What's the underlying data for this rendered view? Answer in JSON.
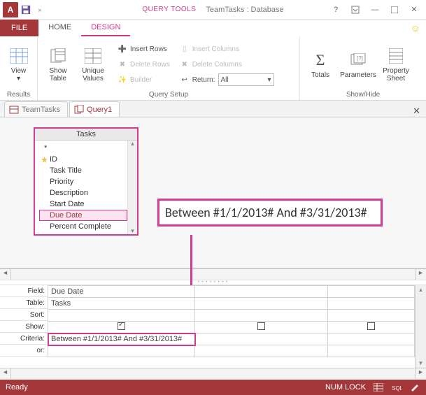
{
  "qat": {
    "app_icon_letter": "A"
  },
  "titlebar": {
    "context_tab": "QUERY TOOLS",
    "db_title": "TeamTasks : Database"
  },
  "tabs": {
    "file": "FILE",
    "home": "HOME",
    "design": "DESIGN"
  },
  "ribbon": {
    "results": {
      "view": "View",
      "label": "Results"
    },
    "querysetup": {
      "show_table": "Show\nTable",
      "unique_values": "Unique\nValues",
      "insert_rows": "Insert Rows",
      "delete_rows": "Delete Rows",
      "builder": "Builder",
      "insert_columns": "Insert Columns",
      "delete_columns": "Delete Columns",
      "return_label": "Return:",
      "return_value": "All",
      "label": "Query Setup"
    },
    "showhide": {
      "totals": "Totals",
      "parameters": "Parameters",
      "property_sheet": "Property\nSheet",
      "label": "Show/Hide"
    }
  },
  "doctabs": {
    "teamtasks": "TeamTasks",
    "query1": "Query1"
  },
  "fieldlist": {
    "title": "Tasks",
    "star": "*",
    "items": [
      "ID",
      "Task Title",
      "Priority",
      "Description",
      "Start Date",
      "Due Date",
      "Percent Complete"
    ]
  },
  "callout": "Between #1/1/2013# And #3/31/2013#",
  "qbe": {
    "labels": [
      "Field:",
      "Table:",
      "Sort:",
      "Show:",
      "Criteria:",
      "or:"
    ],
    "field": "Due Date",
    "table": "Tasks",
    "criteria": "Between #1/1/2013# And #3/31/2013#"
  },
  "statusbar": {
    "ready": "Ready",
    "numlock": "NUM LOCK"
  }
}
